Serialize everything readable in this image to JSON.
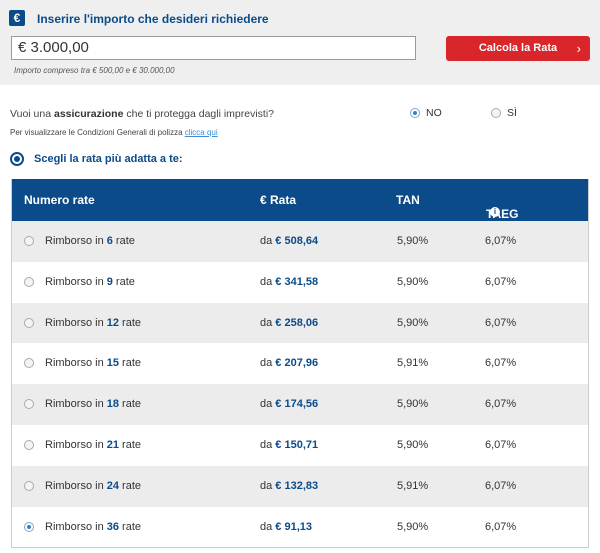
{
  "header": {
    "currency_icon": "€",
    "title": "Inserire l'importo che desideri richiedere",
    "amount_value": "€ 3.000,00",
    "hint": "Importo compreso tra € 500,00 e € 30.000,00",
    "calc_button": "Calcola la Rata",
    "calc_chevron": "›"
  },
  "insurance": {
    "q_before": "Vuoi una ",
    "q_bold": "assicurazione",
    "q_after": " che ti protegga dagli imprevisti?",
    "options": [
      {
        "label": "NO",
        "selected": true
      },
      {
        "label": "SÌ",
        "selected": false
      }
    ],
    "policy_text": "Per visualizzare le Condizioni Generali di polizza ",
    "policy_link": "clicca qui"
  },
  "choose_label": "Scegli la rata più adatta a te:",
  "table": {
    "headers": [
      "Numero rate",
      "€ Rata",
      "TAN",
      "TAEG"
    ],
    "taeg_info_icon": "i",
    "rows": [
      {
        "prefix": "Rimborso in ",
        "n": "6",
        "suffix": " rate",
        "da": "da ",
        "rata": "€ 508,64",
        "tan": "5,90%",
        "taeg": "6,07%",
        "selected": false
      },
      {
        "prefix": "Rimborso in ",
        "n": "9",
        "suffix": " rate",
        "da": "da ",
        "rata": "€ 341,58",
        "tan": "5,90%",
        "taeg": "6,07%",
        "selected": false
      },
      {
        "prefix": "Rimborso in ",
        "n": "12",
        "suffix": " rate",
        "da": "da ",
        "rata": "€ 258,06",
        "tan": "5,90%",
        "taeg": "6,07%",
        "selected": false
      },
      {
        "prefix": "Rimborso in ",
        "n": "15",
        "suffix": " rate",
        "da": "da ",
        "rata": "€ 207,96",
        "tan": "5,91%",
        "taeg": "6,07%",
        "selected": false
      },
      {
        "prefix": "Rimborso in ",
        "n": "18",
        "suffix": " rate",
        "da": "da ",
        "rata": "€ 174,56",
        "tan": "5,90%",
        "taeg": "6,07%",
        "selected": false
      },
      {
        "prefix": "Rimborso in ",
        "n": "21",
        "suffix": " rate",
        "da": "da ",
        "rata": "€ 150,71",
        "tan": "5,90%",
        "taeg": "6,07%",
        "selected": false
      },
      {
        "prefix": "Rimborso in ",
        "n": "24",
        "suffix": " rate",
        "da": "da ",
        "rata": "€ 132,83",
        "tan": "5,91%",
        "taeg": "6,07%",
        "selected": false
      },
      {
        "prefix": "Rimborso in ",
        "n": "36",
        "suffix": " rate",
        "da": "da ",
        "rata": "€ 91,13",
        "tan": "5,90%",
        "taeg": "6,07%",
        "selected": true
      }
    ]
  },
  "colors": {
    "primary": "#0b4b8a",
    "button_red": "#d9262a",
    "link": "#3a8fd6",
    "panel_bg": "#efefef"
  }
}
